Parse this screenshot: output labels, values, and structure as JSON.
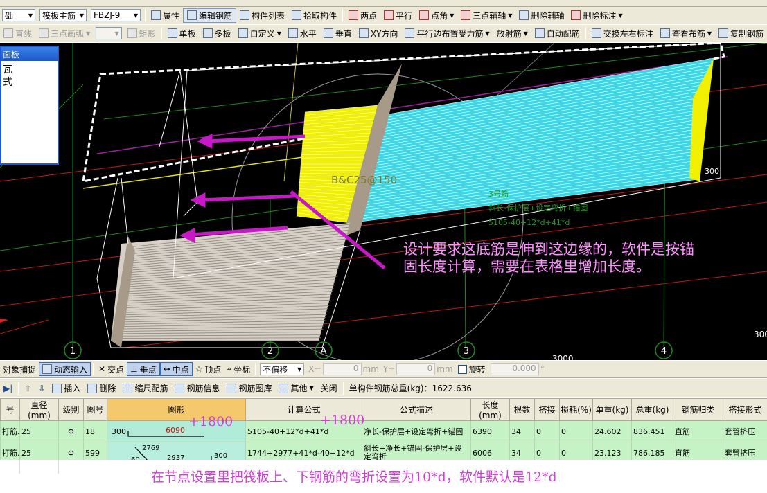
{
  "toolbar_top": {
    "layer_combo": "础",
    "member_combo": "筏板主筋",
    "name_combo": "FBZJ-9",
    "items": [
      "属性",
      "编辑钢筋",
      "构件列表",
      "拾取构件",
      "两点",
      "平行",
      "点角",
      "三点辅轴",
      "删除辅轴",
      "删除标注"
    ]
  },
  "toolbar_draw": {
    "items": [
      "直线",
      "三点画弧",
      "矩形",
      "单板",
      "多板",
      "自定义",
      "水平",
      "垂直",
      "XY方向",
      "平行边布置受力筋",
      "放射筋",
      "自动配筋",
      "交换左右标注",
      "查看布筋",
      "复制钢筋"
    ]
  },
  "side_panel": {
    "title": "面板",
    "lines": [
      "瓦",
      "式"
    ]
  },
  "viewport": {
    "rebar_label": "B&C25@150",
    "axis_numbers": [
      "1",
      "2",
      "A",
      "3",
      "4"
    ],
    "dim_label_1": "300",
    "dim_label_2": "300",
    "dim_label_3": "3000",
    "green_lines": [
      "3号筋",
      "斜长-保护层+设定弯折+锚固",
      "5105-40+12*d+41*d"
    ],
    "annotation_line1": "设计要求这底筋是伸到这边缘的，软件是按锚",
    "annotation_line2": "固长度计算，需要在表格里增加长度。"
  },
  "snap_bar": {
    "items": [
      "对象捕捉",
      "动态输入",
      "交点",
      "垂点",
      "中点",
      "顶点",
      "坐标"
    ],
    "offset_combo": "不偏移",
    "x_label": "X=",
    "x_value": "0",
    "y_label": "Y=",
    "y_value": "0",
    "unit": "mm",
    "rotate_label": "旋转",
    "rotate_value": "0.000",
    "degree": "°"
  },
  "rebar_bar": {
    "items": [
      "插入",
      "删除",
      "缩尺配筋",
      "钢筋信息",
      "钢筋图库",
      "其他",
      "关闭"
    ],
    "total_weight": "单构件钢筋总重(kg)：1622.636"
  },
  "grid": {
    "headers": [
      "号",
      "直径(mm)",
      "级别",
      "图号",
      "图形",
      "计算公式",
      "公式描述",
      "长度(mm)",
      "根数",
      "搭接",
      "损耗(%)",
      "单重(kg)",
      "总重(kg)",
      "钢筋归类",
      "搭接形式"
    ],
    "rows": [
      {
        "name": "打筋.",
        "diameter": "25",
        "grade": "Φ",
        "fig_no": "18",
        "shape_left": "300",
        "shape_mid": "6090",
        "formula": "5105-40+12*d+41*d",
        "desc": "净长-保护层+设定弯折+锚固",
        "length": "6390",
        "count": "34",
        "lap": "0",
        "loss": "0",
        "unit_w": "24.602",
        "total_w": "836.451",
        "category": "直筋",
        "lap_type": "套管挤压"
      },
      {
        "name": "打筋.",
        "diameter": "25",
        "grade": "Φ",
        "fig_no": "599",
        "shape_top": "2769",
        "shape_left": "60",
        "shape_mid": "2937",
        "shape_right": "300",
        "formula": "1744+2977+41*d-40+12*d",
        "desc": "斜长+净长+锚固-保护层+设定弯折",
        "length": "6006",
        "count": "34",
        "lap": "0",
        "loss": "0",
        "unit_w": "23.123",
        "total_w": "786.185",
        "category": "直筋",
        "lap_type": "套管挤压"
      }
    ]
  },
  "overlay_notes": {
    "plus_shape": "+1800",
    "plus_formula": "+1800",
    "bottom_note": "在节点设置里把筏板上、下钢筋的弯折设置为10*d，软件默认是12*d"
  },
  "colors": {
    "annotation": "#d23bd6",
    "cyan_rebar": "#38d8e8",
    "yellow_rebar": "#f0f000",
    "grid_row": "#c6f3c6",
    "header_highlight": "#f5c86b"
  }
}
